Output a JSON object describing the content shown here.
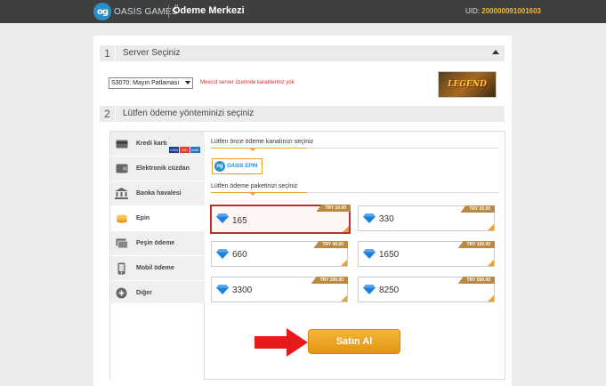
{
  "header": {
    "logo_mark": "og",
    "logo_text": "OASIS GAMES",
    "title": "Ödeme Merkezi",
    "uid_label": "UID:",
    "uid_value": "200000091001603"
  },
  "section1": {
    "number": "1",
    "title": "Server Seçiniz",
    "server_selected": "S3070: Mayın Patlaması",
    "warning": "Mevcut server üzerinde karakteriniz yok",
    "game_logo_text": "LEGEND"
  },
  "section2": {
    "number": "2",
    "title": "Lütfen ödeme yönteminizi seçiniz"
  },
  "methods": [
    {
      "label": "Kredi kartı",
      "icon": "credit-card-icon"
    },
    {
      "label": "Elektronik cüzdan",
      "icon": "wallet-icon"
    },
    {
      "label": "Banka havalesi",
      "icon": "bank-icon"
    },
    {
      "label": "Epin",
      "icon": "coins-icon"
    },
    {
      "label": "Peşin ödeme",
      "icon": "cash-icon"
    },
    {
      "label": "Mobil ödeme",
      "icon": "mobile-icon"
    },
    {
      "label": "Diğer",
      "icon": "plus-icon"
    }
  ],
  "card_logos": [
    "VISA",
    "MC",
    "MAE"
  ],
  "active_method": "Epin",
  "channel": {
    "label": "Lütfen önce ödeme kanalınızı seçiniz",
    "epin_mark": "og",
    "epin_text": "OASIS EPIN"
  },
  "package": {
    "label": "Lütfen ödeme paketinizi seçiniz",
    "items": [
      {
        "amount": "165",
        "price": "TRY 10.00",
        "selected": true
      },
      {
        "amount": "330",
        "price": "TRY 20.00",
        "selected": false
      },
      {
        "amount": "660",
        "price": "TRY 40.00",
        "selected": false
      },
      {
        "amount": "1650",
        "price": "TRY 100.00",
        "selected": false
      },
      {
        "amount": "3300",
        "price": "TRY 200.00",
        "selected": false
      },
      {
        "amount": "8250",
        "price": "TRY 500.00",
        "selected": false
      }
    ]
  },
  "buy_label": "Satın Al",
  "colors": {
    "accent": "#f0a030",
    "selected_border": "#b83232",
    "warning": "#d02a2a",
    "arrow": "#e51b1b",
    "topbar": "#3f3f3f"
  }
}
